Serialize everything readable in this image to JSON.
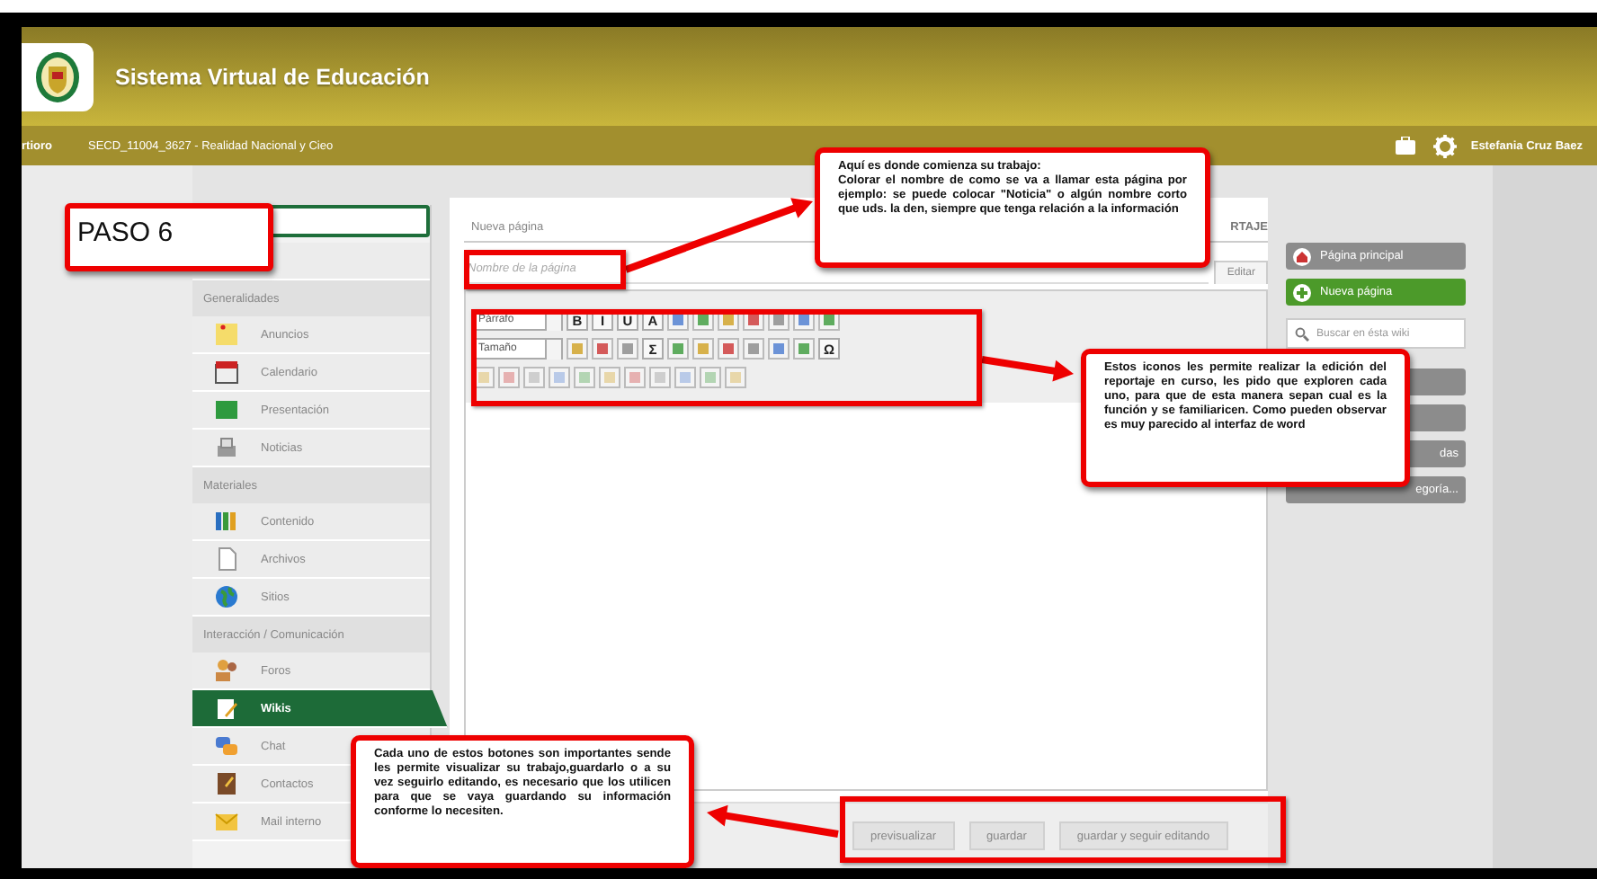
{
  "header": {
    "title": "Sistema Virtual de Educación"
  },
  "breadcrumb": [
    "rtioro",
    "SECD_11004_3627 - Realidad Nacional y Cieo"
  ],
  "user": {
    "name": "Estefania Cruz Baez"
  },
  "sidebar": {
    "rows": [
      {
        "kind": "search"
      },
      {
        "kind": "item",
        "selected": false
      },
      {
        "kind": "header",
        "label": "Generalidades"
      },
      {
        "kind": "item",
        "label": "Anuncios",
        "selected": false
      },
      {
        "kind": "item",
        "label": "Calendario",
        "selected": false
      },
      {
        "kind": "item",
        "label": "Presentación",
        "selected": false
      },
      {
        "kind": "item",
        "label": "Noticias",
        "selected": false
      },
      {
        "kind": "header",
        "label": "Materiales"
      },
      {
        "kind": "item",
        "label": "Contenido",
        "selected": false
      },
      {
        "kind": "item",
        "label": "Archivos",
        "selected": false
      },
      {
        "kind": "item",
        "label": "Sitios",
        "selected": false
      },
      {
        "kind": "header",
        "label": "Interacción / Comunicación"
      },
      {
        "kind": "item",
        "label": "Foros",
        "selected": false
      },
      {
        "kind": "item",
        "label": "Wikis",
        "selected": true
      },
      {
        "kind": "item",
        "label": "Chat",
        "selected": false
      },
      {
        "kind": "item",
        "label": "Contactos",
        "selected": false
      },
      {
        "kind": "item",
        "label": "Mail interno",
        "selected": false
      }
    ]
  },
  "editor": {
    "heading": "Nueva página",
    "tab": "RTAJE",
    "name_field": {
      "placeholder": "Nombre de la página"
    },
    "mode_tab": "Editar",
    "toolbar": [
      [
        {
          "kind": "select",
          "label": "Párrafo"
        },
        {
          "kind": "glyph",
          "label": "B"
        },
        {
          "kind": "glyph",
          "label": "I"
        },
        {
          "kind": "glyph",
          "label": "U"
        },
        {
          "kind": "glyph",
          "label": "A"
        },
        {
          "kind": "icon"
        },
        {
          "kind": "icon"
        },
        {
          "kind": "icon"
        },
        {
          "kind": "icon"
        },
        {
          "kind": "icon"
        },
        {
          "kind": "icon"
        },
        {
          "kind": "icon"
        }
      ],
      [
        {
          "kind": "select",
          "label": "Tamaño"
        },
        {
          "kind": "icon"
        },
        {
          "kind": "icon"
        },
        {
          "kind": "icon"
        },
        {
          "kind": "glyph",
          "label": "Σ"
        },
        {
          "kind": "icon"
        },
        {
          "kind": "icon"
        },
        {
          "kind": "icon"
        },
        {
          "kind": "icon"
        },
        {
          "kind": "icon"
        },
        {
          "kind": "icon"
        },
        {
          "kind": "glyph",
          "label": "Ω"
        }
      ],
      [
        {
          "kind": "icon"
        },
        {
          "kind": "icon"
        },
        {
          "kind": "icon"
        },
        {
          "kind": "icon"
        },
        {
          "kind": "icon"
        },
        {
          "kind": "icon"
        },
        {
          "kind": "icon"
        },
        {
          "kind": "icon"
        },
        {
          "kind": "icon"
        },
        {
          "kind": "icon"
        },
        {
          "kind": "icon"
        }
      ]
    ],
    "buttons": [
      "previsualizar",
      "guardar",
      "guardar y seguir editando"
    ]
  },
  "wiki_menu": [
    {
      "kind": "link",
      "label": "Página principal"
    },
    {
      "kind": "action",
      "label": "Nueva página"
    },
    {
      "kind": "search",
      "placeholder": "Buscar en ésta wiki"
    },
    {
      "kind": "link"
    },
    {
      "kind": "link"
    },
    {
      "kind": "link",
      "label": "das"
    },
    {
      "kind": "link",
      "label": "egoría..."
    }
  ],
  "annotations": [
    {
      "kind": "step",
      "lines": [
        "PASO 6"
      ]
    },
    {
      "kind": "callout",
      "lines": [
        "Aquí es donde comienza su trabajo:",
        "Colorar el nombre de como se va a llamar esta página por ejemplo: se puede colocar \"Noticia\" o algún nombre corto que uds. la den, siempre que tenga relación a la información"
      ]
    },
    {
      "kind": "callout",
      "lines": [
        "Estos iconos les permite realizar la edición del reportaje en curso, les pido que exploren cada uno, para que de esta manera sepan cual es la función y se familiaricen. Como pueden observar es muy parecido al interfaz de word"
      ]
    },
    {
      "kind": "callout",
      "lines": [
        "Cada uno de estos botones son importantes sende les permite visualizar su trabajo,guardarlo o a su vez seguirlo editando, es necesario que los utilicen para que se vaya guardando su información conforme lo necesiten."
      ]
    }
  ]
}
